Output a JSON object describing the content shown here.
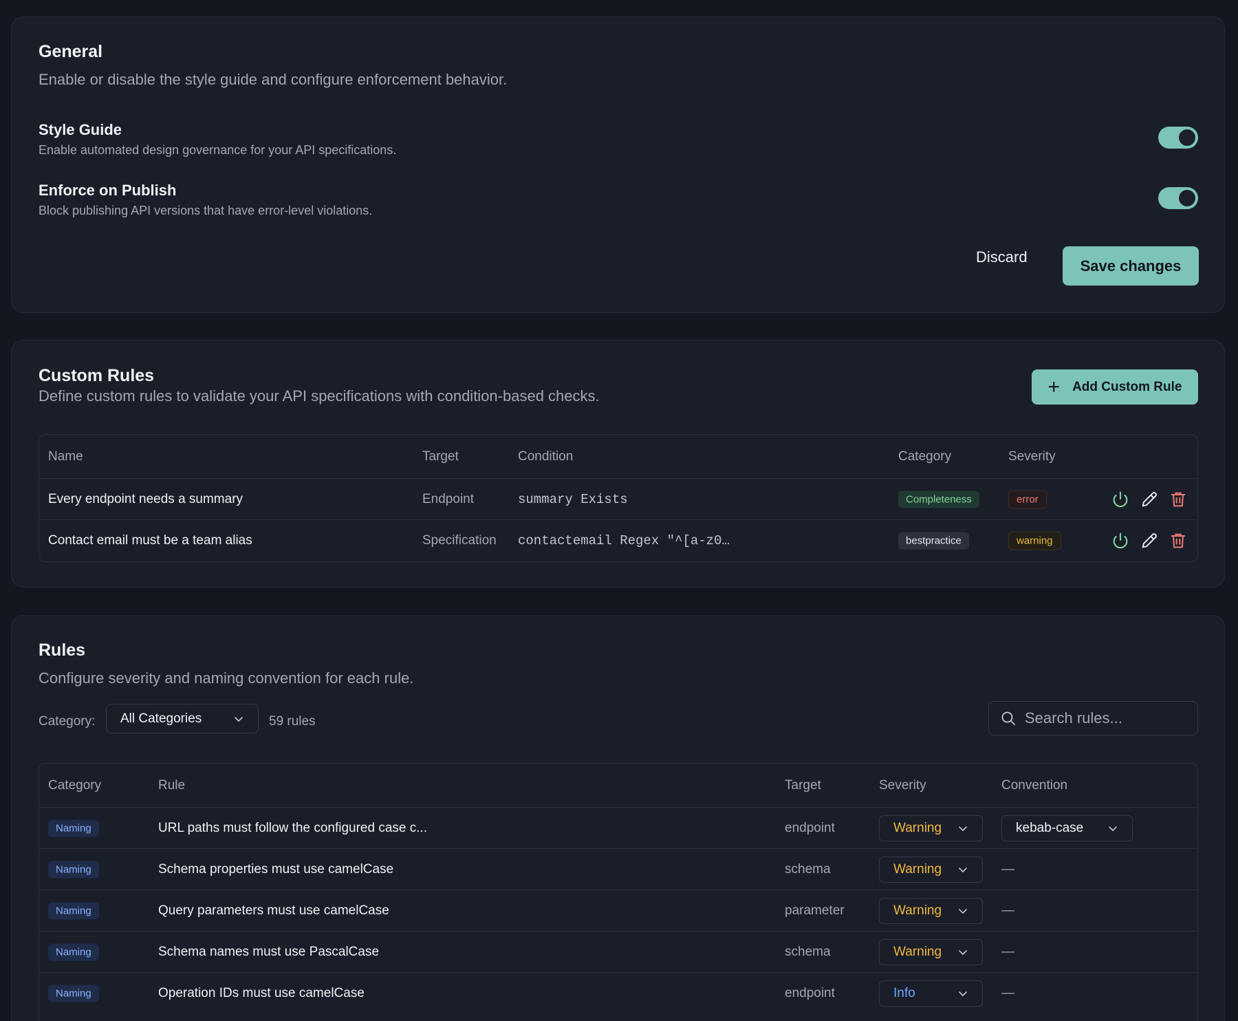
{
  "general": {
    "title": "General",
    "description": "Enable or disable the style guide and configure enforcement behavior.",
    "settings": [
      {
        "title": "Style Guide",
        "description": "Enable automated design governance for your API specifications.",
        "enabled": true
      },
      {
        "title": "Enforce on Publish",
        "description": "Block publishing API versions that have error-level violations.",
        "enabled": true
      }
    ],
    "discard_label": "Discard",
    "save_label": "Save changes"
  },
  "custom_rules": {
    "title": "Custom Rules",
    "description": "Define custom rules to validate your API specifications with condition-based checks.",
    "add_label": "Add Custom Rule",
    "columns": [
      "Name",
      "Target",
      "Condition",
      "Category",
      "Severity"
    ],
    "rows": [
      {
        "name": "Every endpoint needs a summary",
        "target": "Endpoint",
        "condition": "summary Exists",
        "category": "Completeness",
        "severity": "error"
      },
      {
        "name": "Contact email must be a team alias",
        "target": "Specification",
        "condition": "contactemail Regex \"^[a-z0…",
        "category": "bestpractice",
        "severity": "warning"
      }
    ]
  },
  "rules": {
    "title": "Rules",
    "description": "Configure severity and naming convention for each rule.",
    "category_label": "Category:",
    "category_value": "All Categories",
    "count_label": "59 rules",
    "search_placeholder": "Search rules...",
    "columns": [
      "Category",
      "Rule",
      "Target",
      "Severity",
      "Convention"
    ],
    "rows": [
      {
        "category": "Naming",
        "rule": "URL paths must follow the configured case c...",
        "target": "endpoint",
        "severity": "Warning",
        "convention": "kebab-case"
      },
      {
        "category": "Naming",
        "rule": "Schema properties must use camelCase",
        "target": "schema",
        "severity": "Warning",
        "convention": "—"
      },
      {
        "category": "Naming",
        "rule": "Query parameters must use camelCase",
        "target": "parameter",
        "severity": "Warning",
        "convention": "—"
      },
      {
        "category": "Naming",
        "rule": "Schema names must use PascalCase",
        "target": "schema",
        "severity": "Warning",
        "convention": "—"
      },
      {
        "category": "Naming",
        "rule": "Operation IDs must use camelCase",
        "target": "endpoint",
        "severity": "Info",
        "convention": "—"
      }
    ]
  },
  "colors": {
    "accent": "#7cc4b7",
    "background": "#14171f",
    "card": "#1a1e29",
    "error": "#f07a73",
    "warning": "#f1b93c",
    "info": "#6fa4ff",
    "success": "#83d3a0"
  },
  "icons": {
    "toggle_action": "power-icon",
    "edit_action": "pencil-icon",
    "delete_action": "trash-icon",
    "add": "plus-icon",
    "search": "search-icon",
    "dropdown": "chevron-down-icon"
  }
}
